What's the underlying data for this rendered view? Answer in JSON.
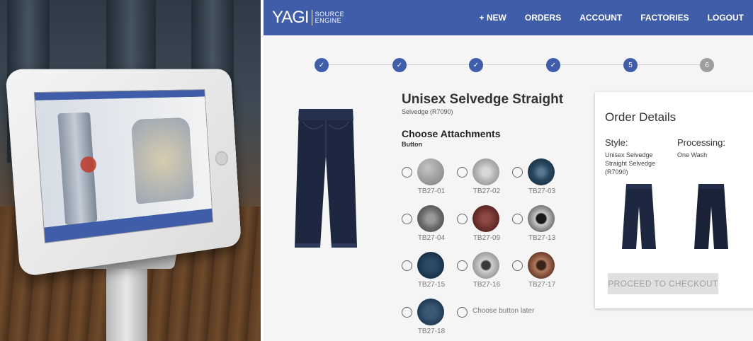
{
  "header": {
    "logo": "YAGI",
    "logo_sub_line1": "SOURCE",
    "logo_sub_line2": "ENGINE",
    "nav": [
      "+ NEW",
      "ORDERS",
      "ACCOUNT",
      "FACTORIES",
      "LOGOUT"
    ]
  },
  "stepper": {
    "steps": [
      {
        "label": "✓",
        "state": "done"
      },
      {
        "label": "✓",
        "state": "done"
      },
      {
        "label": "✓",
        "state": "done"
      },
      {
        "label": "✓",
        "state": "done"
      },
      {
        "label": "5",
        "state": "active"
      },
      {
        "label": "6",
        "state": "pending"
      }
    ]
  },
  "product": {
    "title": "Unisex Selvedge Straight",
    "subtitle": "Selvedge (R7090)"
  },
  "attachments": {
    "heading": "Choose Attachments",
    "subheading": "Button",
    "options": [
      {
        "label": "TB27-01",
        "color": "#9a9a9a"
      },
      {
        "label": "TB27-02",
        "color": "#b8b8b8"
      },
      {
        "label": "TB27-03",
        "color": "#27465e"
      },
      {
        "label": "TB27-04",
        "color": "#6d6d6d"
      },
      {
        "label": "TB27-09",
        "color": "#6b2f2c"
      },
      {
        "label": "TB27-13",
        "color": "#2b2b2b"
      },
      {
        "label": "TB27-15",
        "color": "#1f3a54"
      },
      {
        "label": "TB27-16",
        "color": "#a8a8a8"
      },
      {
        "label": "TB27-17",
        "color": "#7a4733"
      },
      {
        "label": "TB27-18",
        "color": "#2a4560"
      }
    ],
    "later_label": "Choose button later"
  },
  "order": {
    "title": "Order Details",
    "style_label": "Style:",
    "style_value": "Unisex Selvedge Straight Selvedge (R7090)",
    "processing_label": "Processing:",
    "processing_value": "One Wash",
    "checkout_label": "PROCEED TO CHECKOUT"
  },
  "colors": {
    "brand": "#3f5da8",
    "denim": "#1e2740"
  }
}
